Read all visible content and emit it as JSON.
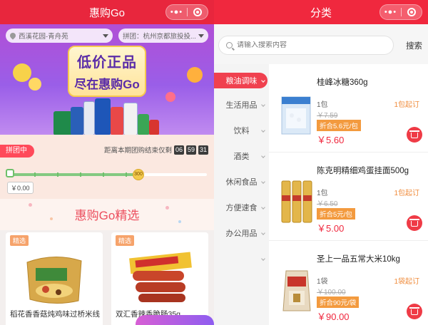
{
  "left": {
    "title": "惠购Go",
    "location": "西溪花园-青舟苑",
    "group": "拼团：杭州京都旅投投...",
    "banner": {
      "line1": "低价正品",
      "line2": "尽在惠购Go"
    },
    "group_status": {
      "badge": "拼团中",
      "countdown_label": "距离本期团购结束仅剩",
      "hours": "06",
      "minutes": "59",
      "seconds": "31",
      "target_amount": "300",
      "current_amount": "￥0.00",
      "progress_fraction": 0.0
    },
    "section_title": "惠购Go精选",
    "cards": [
      {
        "tag": "精选",
        "name": "稻花香香菇炖鸡味过桥米线"
      },
      {
        "tag": "精选",
        "name": "双汇香辣香脆肠35g"
      }
    ]
  },
  "right": {
    "title": "分类",
    "search": {
      "placeholder": "请输入搜索内容",
      "button": "搜索"
    },
    "categories": [
      {
        "label": "粮油调味",
        "active": true
      },
      {
        "label": "生活用品",
        "active": false
      },
      {
        "label": "饮料",
        "active": false
      },
      {
        "label": "酒类",
        "active": false
      },
      {
        "label": "休闲食品",
        "active": false
      },
      {
        "label": "方便速食",
        "active": false
      },
      {
        "label": "办公用品",
        "active": false
      },
      {
        "label": "",
        "active": false
      }
    ],
    "products": [
      {
        "name": "桂峰冰糖360g",
        "unit": "1包",
        "min_qty": "1包起订",
        "old_price": "￥7.59",
        "discount": "折合5.6元/包",
        "price": "￥5.60",
        "image": "sugar-bag"
      },
      {
        "name": "陈克明精细鸡蛋挂面500g",
        "unit": "1包",
        "min_qty": "1包起订",
        "old_price": "￥6.50",
        "discount": "折合5元/包",
        "price": "￥5.00",
        "image": "noodle-packs"
      },
      {
        "name": "圣上一品五常大米10kg",
        "unit": "1袋",
        "min_qty": "1袋起订",
        "old_price": "￥100.00",
        "discount": "折合90元/袋",
        "price": "￥90.00",
        "image": "rice-bag"
      }
    ]
  },
  "colors": {
    "brand_red": "#f0283e",
    "accent_orange": "#f39a3e",
    "banner_purple": "#9a5ee8"
  }
}
